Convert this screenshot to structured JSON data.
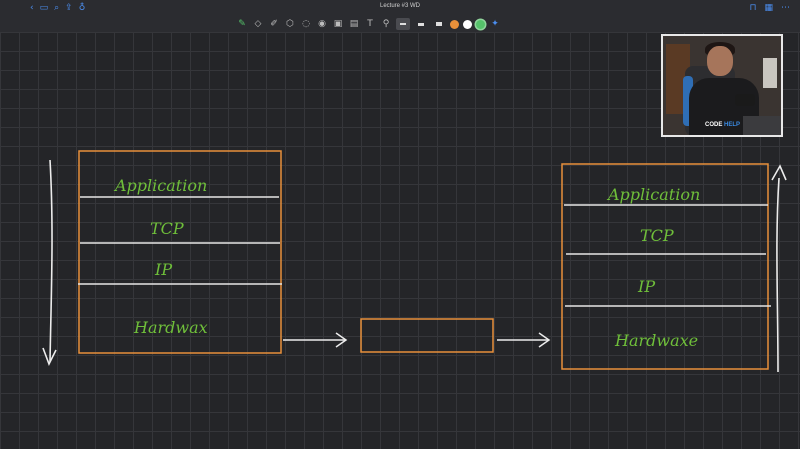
{
  "window": {
    "title": "Lecture #3 WD"
  },
  "toolbar": {
    "colors": [
      "#e8903a",
      "#ffffff",
      "#55c26a"
    ],
    "icons": [
      "pen-icon",
      "eraser-icon",
      "highlighter-icon",
      "shapes-icon",
      "lasso-icon",
      "laser-pointer-icon",
      "image-icon",
      "camera-icon",
      "text-icon",
      "link-icon"
    ]
  },
  "diagram": {
    "left_stack": [
      "Application",
      "TCP",
      "IP",
      "Hardwax"
    ],
    "right_stack": [
      "Application",
      "TCP",
      "IP",
      "Hardwaxe"
    ]
  },
  "video": {
    "shirt_text_1": "CODE",
    "shirt_text_2": "HELP"
  }
}
